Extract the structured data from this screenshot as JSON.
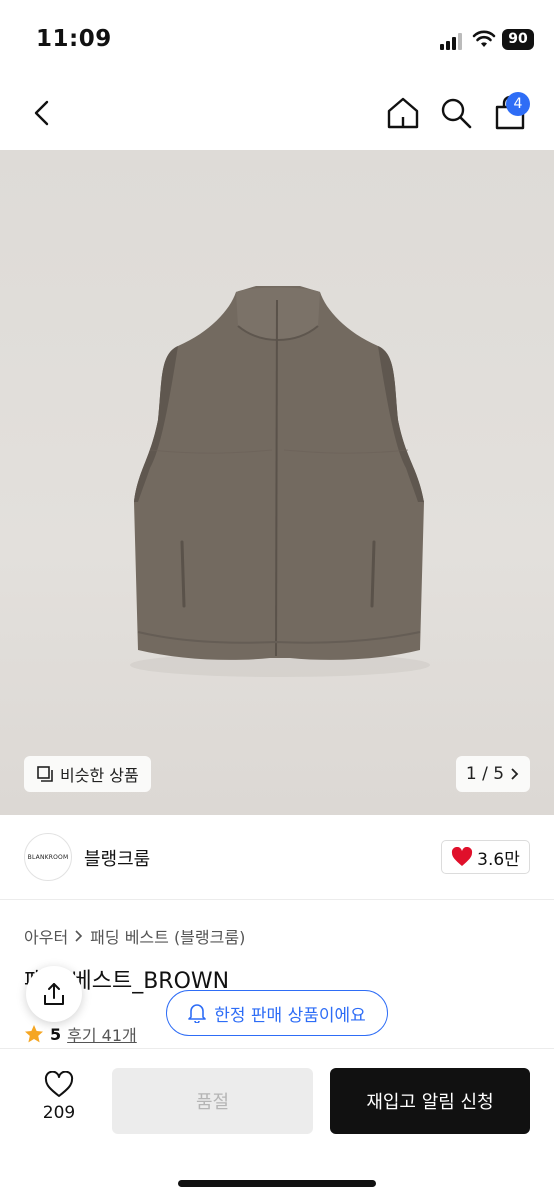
{
  "status_bar": {
    "time": "11:09",
    "battery": "90"
  },
  "nav": {
    "cart_count": "4"
  },
  "image": {
    "similar_label": "비슷한 상품",
    "pager": "1 / 5"
  },
  "brand": {
    "logo_text": "BLANKROOM",
    "name": "블랭크룸",
    "likes": "3.6만"
  },
  "breadcrumb": {
    "items": [
      "아우터",
      "패딩 베스트 (블랭크룸)"
    ]
  },
  "product": {
    "title": "패딩 베스트_BROWN",
    "rating": "5",
    "reviews": "후기 41개"
  },
  "limited_notice": "한정 판매 상품이에요",
  "bottom": {
    "wish_count": "209",
    "soldout_label": "품절",
    "restock_label": "재입고 알림 신청"
  },
  "colors": {
    "accent": "#2e6df6",
    "heart": "#e0102b",
    "star": "#f5a623",
    "vest": "#736a60"
  },
  "icons": [
    "back-icon",
    "home-icon",
    "search-icon",
    "cart-icon",
    "similar-icon",
    "chevron-right-icon",
    "heart-icon",
    "star-icon",
    "share-icon",
    "bell-icon"
  ]
}
